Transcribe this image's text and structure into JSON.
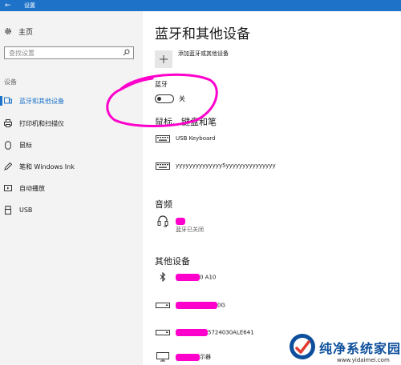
{
  "window": {
    "title": "设置",
    "back": "←"
  },
  "sidebar": {
    "home_label": "主页",
    "search_placeholder": "查找设置",
    "category": "设备",
    "items": [
      {
        "label": "蓝牙和其他设备",
        "icon": "bluetooth-devices-icon",
        "active": true
      },
      {
        "label": "打印机和扫描仪",
        "icon": "printer-icon"
      },
      {
        "label": "鼠标",
        "icon": "mouse-icon"
      },
      {
        "label": "笔和 Windows Ink",
        "icon": "pen-icon"
      },
      {
        "label": "自动播放",
        "icon": "autoplay-icon"
      },
      {
        "label": "USB",
        "icon": "usb-icon"
      }
    ]
  },
  "main": {
    "title": "蓝牙和其他设备",
    "add_device_label": "添加蓝牙或其他设备",
    "bluetooth": {
      "label": "蓝牙",
      "state": "关",
      "on": false
    },
    "mouse_section": {
      "heading": "鼠标、键盘和笔",
      "devices": [
        {
          "name": "USB Keyboard",
          "icon": "keyboard-icon"
        },
        {
          "name": "yyyyyyyyyyyyyy5yyyyyyyyyyyyyyy",
          "icon": "keyboard-icon"
        }
      ]
    },
    "audio_section": {
      "heading": "音频",
      "devices": [
        {
          "name": "",
          "status": "蓝牙已关闭",
          "icon": "headset-icon",
          "redacted": true
        }
      ]
    },
    "other_section": {
      "heading": "其他设备",
      "devices": [
        {
          "name_visible": "0 A10",
          "icon": "bluetooth-icon",
          "redacted": true
        },
        {
          "name_visible": "0G",
          "icon": "drive-icon",
          "redacted": true
        },
        {
          "name_visible": "5724030ALE641",
          "icon": "drive-icon",
          "redacted": true
        },
        {
          "name_visible": "示器",
          "icon": "monitor-icon",
          "redacted": true
        }
      ]
    }
  },
  "watermark": {
    "brand": "纯净系统家园",
    "url": "www.yidaimei.com"
  },
  "colors": {
    "accent": "#1e73c9",
    "annotation": "#ff00cc",
    "sidebar_bg": "#f3f3f3"
  }
}
